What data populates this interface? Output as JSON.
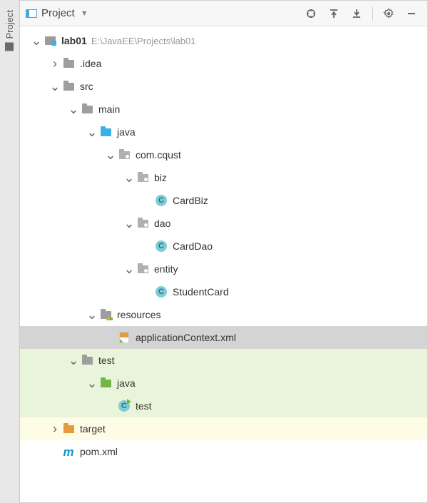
{
  "sidebar": {
    "tab_label": "Project"
  },
  "header": {
    "title": "Project"
  },
  "tree": [
    {
      "depth": 0,
      "arrow": "down",
      "icon": "module",
      "label": "lab01",
      "bold": true,
      "path": "E:\\JavaEE\\Projects\\lab01",
      "hl": ""
    },
    {
      "depth": 1,
      "arrow": "right",
      "icon": "folder-grey",
      "label": ".idea",
      "hl": ""
    },
    {
      "depth": 1,
      "arrow": "down",
      "icon": "folder-grey",
      "label": "src",
      "hl": ""
    },
    {
      "depth": 2,
      "arrow": "down",
      "icon": "folder-grey",
      "label": "main",
      "hl": ""
    },
    {
      "depth": 3,
      "arrow": "down",
      "icon": "folder-blue",
      "label": "java",
      "hl": ""
    },
    {
      "depth": 4,
      "arrow": "down",
      "icon": "package",
      "label": "com.cqust",
      "hl": ""
    },
    {
      "depth": 5,
      "arrow": "down",
      "icon": "package",
      "label": "biz",
      "hl": ""
    },
    {
      "depth": 6,
      "arrow": "none",
      "icon": "class",
      "label": "CardBiz",
      "hl": ""
    },
    {
      "depth": 5,
      "arrow": "down",
      "icon": "package",
      "label": "dao",
      "hl": ""
    },
    {
      "depth": 6,
      "arrow": "none",
      "icon": "class",
      "label": "CardDao",
      "hl": ""
    },
    {
      "depth": 5,
      "arrow": "down",
      "icon": "package",
      "label": "entity",
      "hl": ""
    },
    {
      "depth": 6,
      "arrow": "none",
      "icon": "class",
      "label": "StudentCard",
      "hl": ""
    },
    {
      "depth": 3,
      "arrow": "down",
      "icon": "resources",
      "label": "resources",
      "hl": ""
    },
    {
      "depth": 4,
      "arrow": "none",
      "icon": "xml",
      "label": "applicationContext.xml",
      "hl": "selected"
    },
    {
      "depth": 2,
      "arrow": "down",
      "icon": "folder-grey",
      "label": "test",
      "hl": "green"
    },
    {
      "depth": 3,
      "arrow": "down",
      "icon": "folder-green",
      "label": "java",
      "hl": "green"
    },
    {
      "depth": 4,
      "arrow": "none",
      "icon": "class-test",
      "label": "test",
      "hl": "green"
    },
    {
      "depth": 1,
      "arrow": "right",
      "icon": "folder-orange",
      "label": "target",
      "hl": "yellow"
    },
    {
      "depth": 1,
      "arrow": "none",
      "icon": "maven",
      "label": "pom.xml",
      "hl": ""
    }
  ]
}
